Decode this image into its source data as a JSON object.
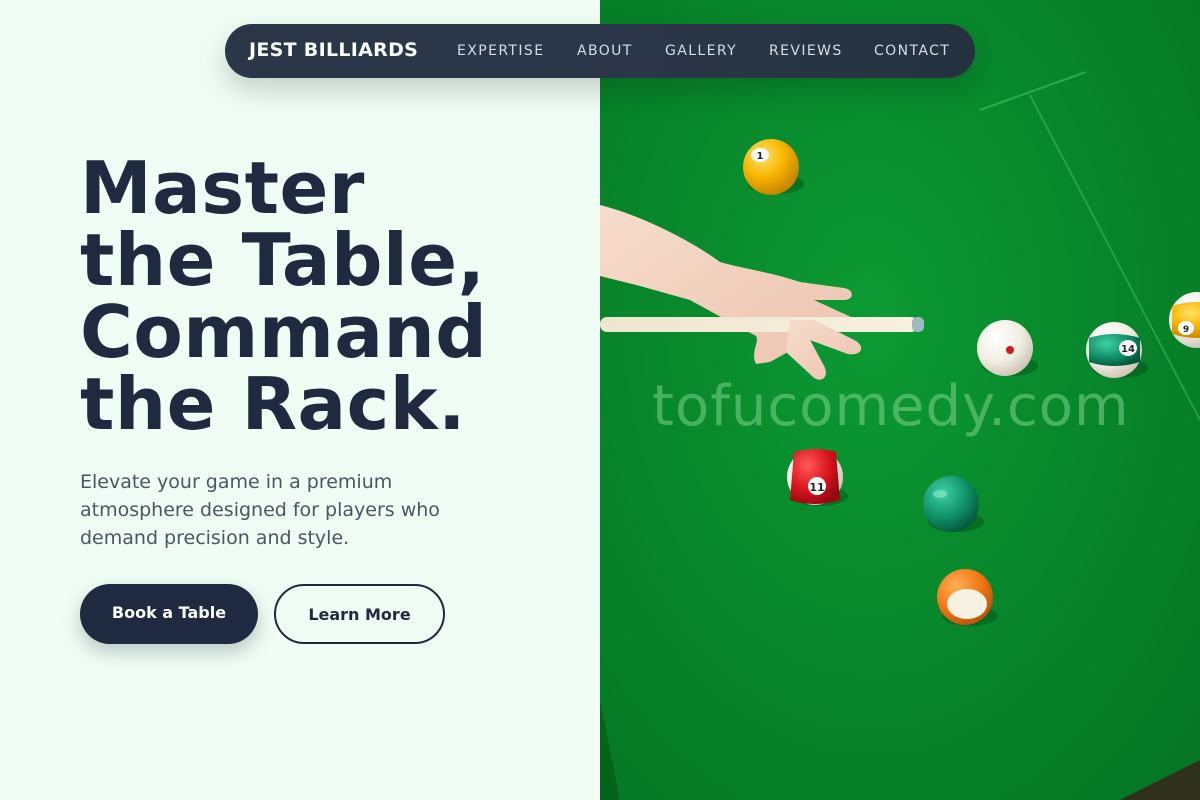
{
  "nav": {
    "brand": "JEST BILLIARDS",
    "links": [
      "EXPERTISE",
      "ABOUT",
      "GALLERY",
      "REVIEWS",
      "CONTACT"
    ]
  },
  "hero": {
    "headline_lines": [
      "Master",
      "the Table,",
      "Command",
      "the Rack."
    ],
    "subtext": "Elevate your game in a premium atmosphere designed for players who demand precision and style.",
    "primary_button": "Book a Table",
    "secondary_button": "Learn More"
  },
  "image": {
    "watermark": "tofucomedy.com",
    "ball_numbers": [
      "1",
      "11",
      "14",
      "9"
    ]
  },
  "colors": {
    "page_background": "#effdf4",
    "text_dark": "#1f2940",
    "navbar": "#2b3648",
    "felt_green": "#08882c"
  }
}
